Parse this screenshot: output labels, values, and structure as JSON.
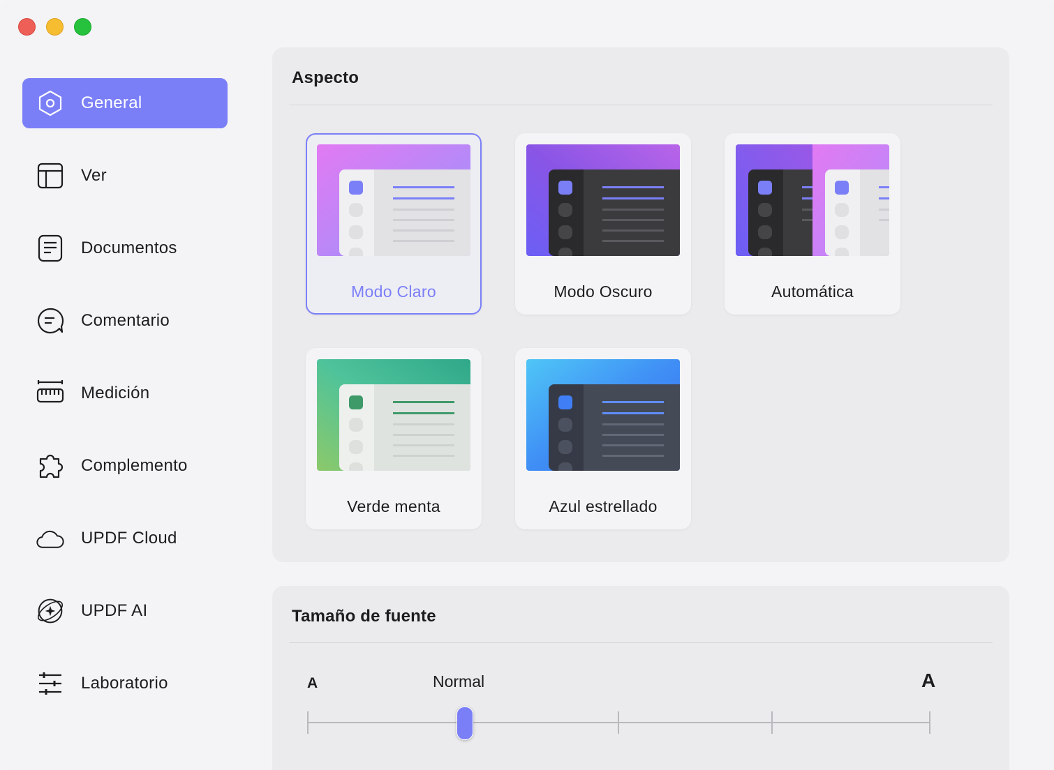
{
  "sidebar": {
    "items": [
      {
        "label": "General",
        "icon": "gear-icon",
        "active": true
      },
      {
        "label": "Ver",
        "icon": "layout-icon"
      },
      {
        "label": "Documentos",
        "icon": "document-icon"
      },
      {
        "label": "Comentario",
        "icon": "comment-icon"
      },
      {
        "label": "Medición",
        "icon": "ruler-icon"
      },
      {
        "label": "Complemento",
        "icon": "puzzle-icon"
      },
      {
        "label": "UPDF Cloud",
        "icon": "cloud-icon"
      },
      {
        "label": "UPDF AI",
        "icon": "ai-icon"
      },
      {
        "label": "Laboratorio",
        "icon": "sliders-icon"
      }
    ]
  },
  "appearance": {
    "title": "Aspecto",
    "themes": [
      {
        "label": "Modo Claro",
        "selected": true
      },
      {
        "label": "Modo Oscuro"
      },
      {
        "label": "Automática"
      },
      {
        "label": "Verde menta"
      },
      {
        "label": "Azul estrellado"
      }
    ]
  },
  "font_size": {
    "title": "Tamaño de fuente",
    "small_label": "A",
    "current_label": "Normal",
    "large_label": "A",
    "steps": 5,
    "current_step": 2
  },
  "colors": {
    "accent": "#7b7ff7",
    "close": "#ed5f57",
    "minimize": "#f5bd2f",
    "maximize": "#27c23d"
  }
}
